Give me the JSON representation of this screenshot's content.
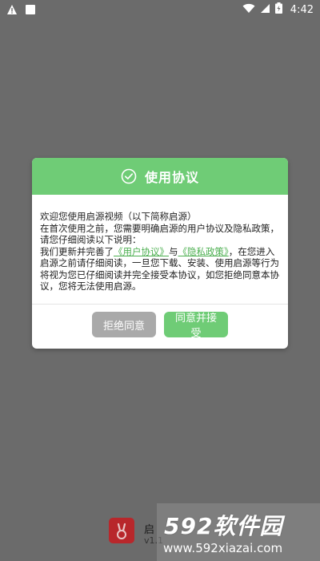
{
  "status_bar": {
    "time": "4:42"
  },
  "dialog": {
    "title": "使用协议",
    "body_intro": "欢迎您使用启源视频（以下简称启源）",
    "body_line2": "在首次使用之前，您需要明确启源的用户协议及隐私政策，请您仔细阅读以下说明：",
    "body_update_prefix": "我们更新并完善了",
    "user_agreement_link": "《用户协议》",
    "and_text": "与",
    "privacy_policy_link": "《隐私政策》",
    "body_update_suffix": "，在您进入启源之前请仔细阅读，一旦您下载、安装、使用启源等行为将视为您已仔细阅读并完全接受本协议，如您拒绝同意本协议，您将无法使用启源。",
    "reject_label": "拒绝同意",
    "agree_label": "同意并接受"
  },
  "app": {
    "name_partial": "启",
    "version_partial": "v1.1"
  },
  "watermark": {
    "top": "592软件园",
    "bottom": "www.592xiazai.com"
  },
  "colors": {
    "accent_green": "#6fcc76",
    "link_green": "#4caf50",
    "reject_gray": "#a9a9a9",
    "overlay_gray": "#6b6b6b"
  }
}
